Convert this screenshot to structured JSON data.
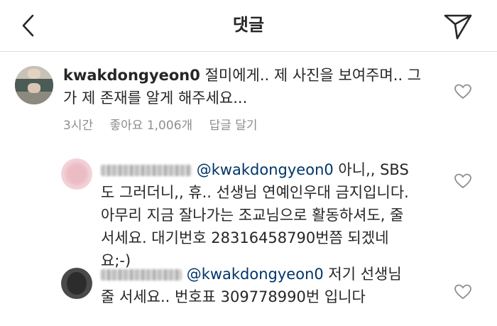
{
  "header": {
    "title": "댓글",
    "back_icon": "chevron-left-icon",
    "send_icon": "send-icon"
  },
  "main_comment": {
    "username": "kwakdongyeon0",
    "text_line1": "절미에게.. 제 사진을 보여주며.. 그",
    "text_line2": "가 제 존재를 알게 해주세요...",
    "time": "3시간",
    "likes": "좋아요 1,006개",
    "reply": "답글 달기"
  },
  "replies": [
    {
      "mention": "@kwakdongyeon0",
      "line1_rest": " 아니,, SBS",
      "line2": "도 그러더니,, 휴.. 선생님 연예인우대 금지입니다.",
      "line3": "아무리 지금 잘나가는 조교님으로 활동하셔도, 줄",
      "line4": "서세요. 대기번호 28316458790번쯤 되겠네",
      "line5": "요;-)"
    },
    {
      "mention": "@kwakdongyeon0",
      "line1_rest": " 저기 선생님",
      "line2": "줄 서세요.. 번호표 309778990번 입니다"
    }
  ],
  "colors": {
    "mention": "#003569",
    "meta": "#8e8e8e",
    "text": "#262626",
    "divider": "#dbdbdb"
  }
}
